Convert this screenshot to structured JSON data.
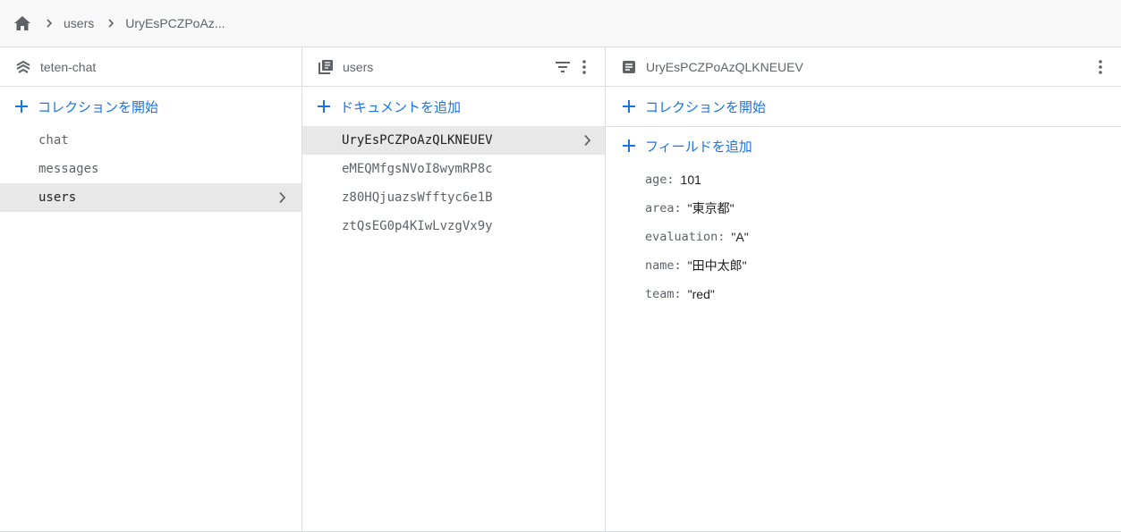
{
  "breadcrumb": {
    "home_icon": "home-icon",
    "items": [
      "users",
      "UryEsPCZPoAz..."
    ]
  },
  "collections_panel": {
    "title": "teten-chat",
    "icon": "database-layers-icon",
    "start_collection_label": "コレクションを開始",
    "items": [
      {
        "label": "chat",
        "selected": false
      },
      {
        "label": "messages",
        "selected": false
      },
      {
        "label": "users",
        "selected": true
      }
    ]
  },
  "documents_panel": {
    "title": "users",
    "icon": "collection-icon",
    "add_document_label": "ドキュメントを追加",
    "items": [
      {
        "label": "UryEsPCZPoAzQLKNEUEV",
        "selected": true
      },
      {
        "label": "eMEQMfgsNVoI8wymRP8c",
        "selected": false
      },
      {
        "label": "z80HQjuazsWfftyc6e1B",
        "selected": false
      },
      {
        "label": "ztQsEG0p4KIwLvzgVx9y",
        "selected": false
      }
    ]
  },
  "fields_panel": {
    "title": "UryEsPCZPoAzQLKNEUEV",
    "icon": "document-icon",
    "start_collection_label": "コレクションを開始",
    "add_field_label": "フィールドを追加",
    "fields": [
      {
        "key": "age",
        "value": "101"
      },
      {
        "key": "area",
        "value": "\"東京都\""
      },
      {
        "key": "evaluation",
        "value": "\"A\""
      },
      {
        "key": "name",
        "value": "\"田中太郎\""
      },
      {
        "key": "team",
        "value": "\"red\""
      }
    ]
  },
  "colors": {
    "accent": "#1a73e8",
    "selected_bg": "#e8e8e8",
    "icon_gray": "#5f6368"
  }
}
